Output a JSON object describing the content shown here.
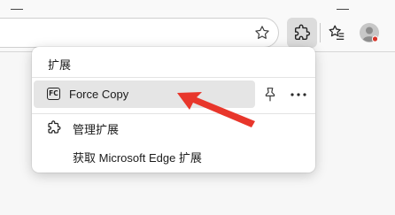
{
  "menu": {
    "title": "扩展",
    "extension": {
      "name": "Force Copy",
      "icon_text": "FC"
    },
    "manage_label": "管理扩展",
    "get_label": "获取 Microsoft Edge 扩展"
  },
  "icons": {
    "star": "star-icon",
    "extensions": "puzzle-icon",
    "favorites": "favorites-icon",
    "profile": "avatar-icon",
    "pin": "pin-icon",
    "more": "more-icon",
    "manage": "puzzle-icon"
  },
  "colors": {
    "highlight_row": "#e5e5e5",
    "arrow": "#e8362b"
  }
}
